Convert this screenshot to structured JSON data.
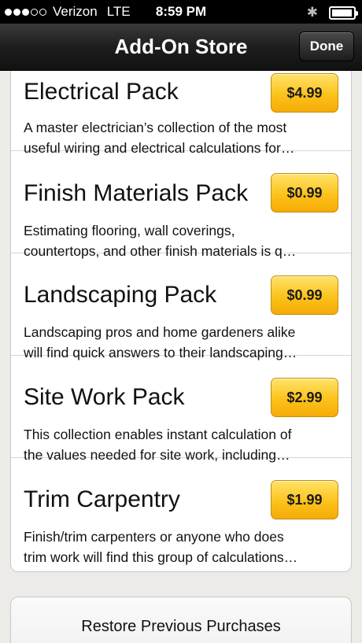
{
  "status_bar": {
    "carrier": "Verizon",
    "network": "LTE",
    "time": "8:59 PM",
    "signal_bars": 2,
    "signal_total": 5,
    "bluetooth_icon": "bluetooth-icon",
    "battery_icon": "battery-icon"
  },
  "nav": {
    "title": "Add-On Store",
    "done_label": "Done"
  },
  "products": [
    {
      "title": "Electrical Pack",
      "price": "$4.99",
      "desc_line1": "A master electrician’s collection of the most",
      "desc_line2": "useful wiring and electrical calculations for…"
    },
    {
      "title": "Finish Materials Pack",
      "price": "$0.99",
      "desc_line1": "Estimating flooring, wall coverings,",
      "desc_line2": "countertops, and other finish materials is q…"
    },
    {
      "title": "Landscaping Pack",
      "price": "$0.99",
      "desc_line1": "Landscaping pros and home gardeners alike",
      "desc_line2": "will find quick answers to their landscaping…"
    },
    {
      "title": "Site Work Pack",
      "price": "$2.99",
      "desc_line1": "This collection enables instant calculation of",
      "desc_line2": "the values needed for site work, including…"
    },
    {
      "title": "Trim Carpentry",
      "price": "$1.99",
      "desc_line1": "Finish/trim carpenters or anyone who does",
      "desc_line2": "trim work will find this group of calculations…"
    }
  ],
  "restore": {
    "label": "Restore Previous Purchases"
  },
  "colors": {
    "price_button": "#fcc21b",
    "nav_bar": "#1e1e1e",
    "background": "#ecebe7"
  }
}
